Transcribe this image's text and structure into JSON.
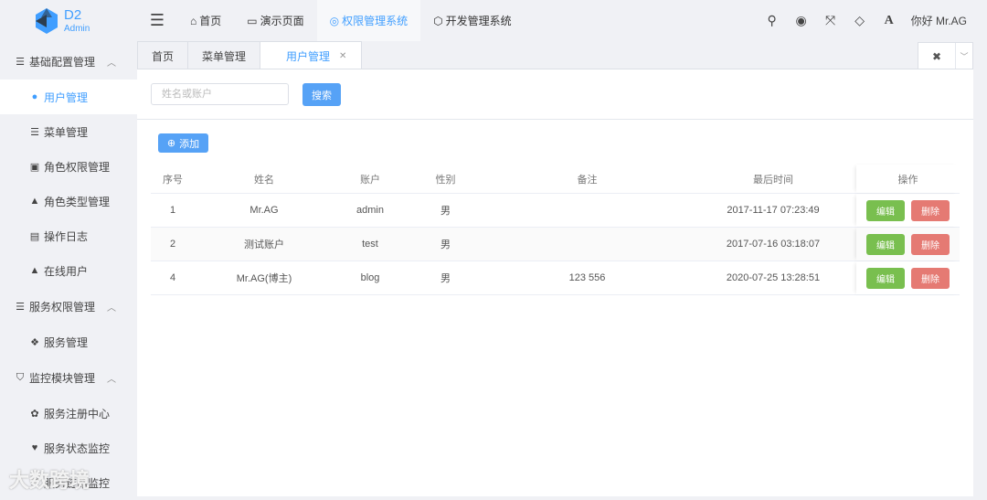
{
  "brand": {
    "name": "D2",
    "sub": "Admin",
    "color": "#409eff"
  },
  "topnav": [
    {
      "icon": "home-icon",
      "label": "首页"
    },
    {
      "icon": "folder-icon",
      "label": "演示页面"
    },
    {
      "icon": "chrome-icon",
      "label": "权限管理系统",
      "active": true
    },
    {
      "icon": "hexagon-icon",
      "label": "开发管理系统"
    }
  ],
  "tools": [
    "search-icon",
    "target-icon",
    "fullscreen-icon",
    "diamond-icon",
    "font-icon"
  ],
  "user": "你好 Mr.AG",
  "sidebar": [
    {
      "type": "group",
      "icon": "list-icon",
      "label": "基础配置管理"
    },
    {
      "type": "child",
      "icon": "user-icon",
      "label": "用户管理",
      "active": true
    },
    {
      "type": "child",
      "icon": "list-icon",
      "label": "菜单管理"
    },
    {
      "type": "child",
      "icon": "id-card-icon",
      "label": "角色权限管理"
    },
    {
      "type": "child",
      "icon": "lock-icon",
      "label": "角色类型管理"
    },
    {
      "type": "child",
      "icon": "file-icon",
      "label": "操作日志"
    },
    {
      "type": "child",
      "icon": "lock-icon",
      "label": "在线用户"
    },
    {
      "type": "group",
      "icon": "server-icon",
      "label": "服务权限管理"
    },
    {
      "type": "child",
      "icon": "cubes-icon",
      "label": "服务管理"
    },
    {
      "type": "group",
      "icon": "shield-icon",
      "label": "监控模块管理"
    },
    {
      "type": "child",
      "icon": "paw-icon",
      "label": "服务注册中心"
    },
    {
      "type": "child",
      "icon": "heartbeat-icon",
      "label": "服务状态监控"
    },
    {
      "type": "child",
      "icon": "line-chart-icon",
      "label": "服务链路监控"
    }
  ],
  "tabs": [
    {
      "label": "首页"
    },
    {
      "label": "菜单管理"
    },
    {
      "label": "用户管理",
      "active": true
    }
  ],
  "search": {
    "placeholder": "姓名或账户",
    "button": "搜索"
  },
  "add_button": "添加",
  "table": {
    "columns": [
      "序号",
      "姓名",
      "账户",
      "性别",
      "备注",
      "最后时间",
      "操作"
    ],
    "rows": [
      [
        "1",
        "Mr.AG",
        "admin",
        "男",
        "",
        "2017-11-17 07:23:49"
      ],
      [
        "2",
        "测试账户",
        "test",
        "男",
        "",
        "2017-07-16 03:18:07"
      ],
      [
        "4",
        "Mr.AG(博主)",
        "blog",
        "男",
        "123 556",
        "2020-07-25 13:28:51"
      ]
    ],
    "edit": "编辑",
    "delete": "删除"
  },
  "watermark": "大数跨境"
}
